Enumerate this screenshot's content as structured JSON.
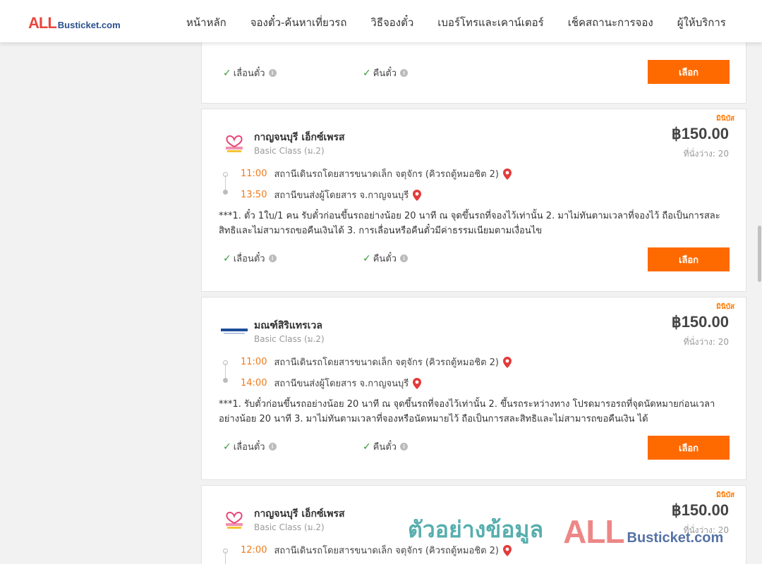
{
  "brand": {
    "logo_all": "ALL",
    "logo_rest": "Busticket.com"
  },
  "nav": [
    {
      "label": "หน้าหลัก"
    },
    {
      "label": "จองตั๋ว-ค้นหาเที่ยวรถ"
    },
    {
      "label": "วิธีจองตั๋ว"
    },
    {
      "label": "เบอร์โทรและเคาน์เตอร์"
    },
    {
      "label": "เช็คสถานะการจอง"
    },
    {
      "label": "ผู้ให้บริการ"
    }
  ],
  "labels": {
    "change_ticket": "เลื่อนตั๋ว",
    "refund_ticket": "คืนตั๋ว",
    "select_button": "เลือก",
    "minibus_badge": "มินิบัส"
  },
  "results": [
    {
      "note_partial": "เป็นการสละสิทธิ์และไม่สามารถขอคืนเงินได้ 3. การเลื่อนหรือคืนตั๋วมีค่าธรรมเนียมตามเงื่อนไข"
    },
    {
      "operator": "กาญจนบุรี เอ็กซ์เพรส",
      "class": "Basic Class (ม.2)",
      "price": "฿150.00",
      "seats": "ที่นั่งว่าง: 20",
      "depart_time": "11:00",
      "depart_place": "สถานีเดินรถโดยสารขนาดเล็ก จตุจักร (คิวรถตู้หมอชิต 2)",
      "arrive_time": "13:50",
      "arrive_place": "สถานีขนส่งผู้โดยสาร จ.กาญจนบุรี",
      "note": "***1. ตั๋ว 1ใบ/1 คน รับตั๋วก่อนขึ้นรถอย่างน้อย 20 นาที ณ จุดขึ้นรถที่จองไว้เท่านั้น 2. มาไม่ทันตามเวลาที่จองไว้ ถือเป็นการสละสิทธิและไม่สามารถขอคืนเงินได้ 3. การเลื่อนหรือคืนตั๋วมีค่าธรรมเนียมตามเงื่อนไข"
    },
    {
      "operator": "มณฑ์สิริแทรเวล",
      "class": "Basic Class (ม.2)",
      "price": "฿150.00",
      "seats": "ที่นั่งว่าง: 20",
      "depart_time": "11:00",
      "depart_place": "สถานีเดินรถโดยสารขนาดเล็ก จตุจักร (คิวรถตู้หมอชิต 2)",
      "arrive_time": "14:00",
      "arrive_place": "สถานีขนส่งผู้โดยสาร จ.กาญจนบุรี",
      "note": "***1. รับตั๋วก่อนขึ้นรถอย่างน้อย 20 นาที ณ จุดขึ้นรถที่จองไว้เท่านั้น 2. ขึ้นรถระหว่างทาง โปรดมารอรถที่จุดนัดหมายก่อนเวลาอย่างน้อย 20 นาที 3. มาไม่ทันตามเวลาที่จองหรือนัดหมายไว้ ถือเป็นการสละสิทธิและไม่สามารถขอคืนเงิน ได้"
    },
    {
      "operator": "กาญจนบุรี เอ็กซ์เพรส",
      "class": "Basic Class (ม.2)",
      "price": "฿150.00",
      "seats": "ที่นั่งว่าง: 20",
      "depart_time": "12:00",
      "depart_place": "สถานีเดินรถโดยสารขนาดเล็ก จตุจักร (คิวรถตู้หมอชิต 2)"
    }
  ],
  "watermark": {
    "thai": "ตัวอย่างข้อมูล",
    "all": "ALL",
    "rest": "Busticket.com"
  },
  "colors": {
    "accent": "#ff6a00",
    "time": "#f07a1a",
    "check": "#3a9a3a",
    "pin": "#e23b3b"
  },
  "icons": [
    "check-icon",
    "info-icon",
    "map-pin-icon",
    "heart-logo-icon"
  ]
}
